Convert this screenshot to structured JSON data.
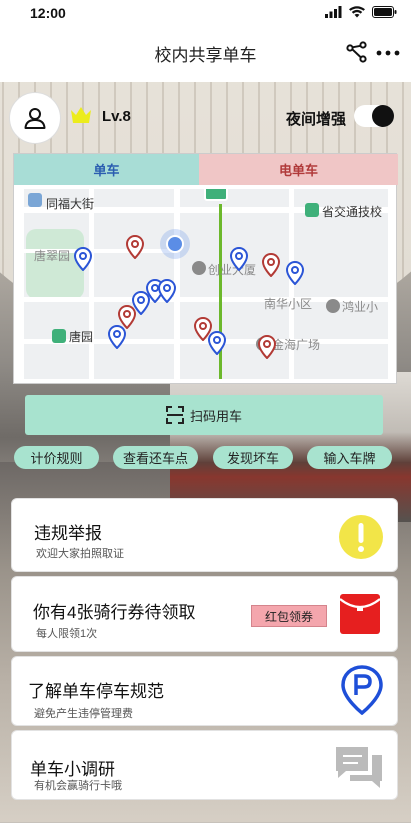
{
  "status": {
    "time": "12:00"
  },
  "header": {
    "title": "校内共享单车"
  },
  "profile": {
    "level": "Lv.8",
    "night_label": "夜间增强",
    "night_mode_on": true
  },
  "map_card": {
    "tabs": [
      {
        "label": "单车"
      },
      {
        "label": "电单车"
      }
    ],
    "labels": {
      "tongfu": "同福大街",
      "tangcui": "唐翠园",
      "chuangye": "创业大厦",
      "shengjiao": "省交通技校",
      "nanhua": "南华小区",
      "honghai": "鸿业小",
      "jinhai": "金海广场",
      "tangyuan": "唐园"
    }
  },
  "actions": {
    "scan_label": "扫码用车",
    "pills": [
      "计价规则",
      "查看还车点",
      "发现坏车",
      "输入车牌"
    ]
  },
  "cards": {
    "report": {
      "title": "违规举报",
      "subtitle": "欢迎大家拍照取证"
    },
    "coupon": {
      "title": "你有4张骑行券待领取",
      "subtitle": "每人限领1次",
      "tag": "红包领券"
    },
    "parking": {
      "title": "了解单车停车规范",
      "subtitle": "避免产生违停管理费"
    },
    "survey": {
      "title": "单车小调研",
      "subtitle": "有机会赢骑行卡哦"
    }
  },
  "colors": {
    "mint": "#a8e3cf",
    "blue_pin": "#2b55d6",
    "red_pin": "#b23a35",
    "coupon_red": "#e61f1f",
    "warning_yellow": "#f2e548"
  }
}
